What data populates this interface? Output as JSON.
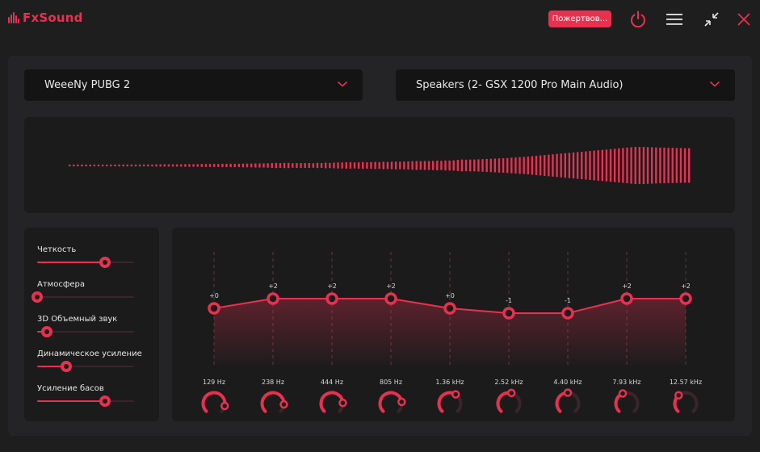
{
  "app": {
    "logo_text": "FxSound",
    "donate_label": "Пожертвов...",
    "accent_color": "#e8314f",
    "icons": [
      "power-icon",
      "menu-icon",
      "minimize-icon",
      "close-icon"
    ]
  },
  "preset": {
    "value": "WeeeNy PUBG 2"
  },
  "output": {
    "value": "Speakers (2- GSX 1200 Pro Main Audio)"
  },
  "effects": [
    {
      "label": "Четкость",
      "level": 0.7
    },
    {
      "label": "Атмосфера",
      "level": 0.0
    },
    {
      "label": "3D Объемный звук",
      "level": 0.1
    },
    {
      "label": "Динамическое усиление",
      "level": 0.3
    },
    {
      "label": "Усиление басов",
      "level": 0.7
    }
  ],
  "eq": {
    "bands": [
      {
        "freq": "129 Hz",
        "gain": 0,
        "gain_label": "+0"
      },
      {
        "freq": "238 Hz",
        "gain": 2,
        "gain_label": "+2"
      },
      {
        "freq": "444 Hz",
        "gain": 2,
        "gain_label": "+2"
      },
      {
        "freq": "805 Hz",
        "gain": 2,
        "gain_label": "+2"
      },
      {
        "freq": "1.36 kHz",
        "gain": 0,
        "gain_label": "+0"
      },
      {
        "freq": "2.52 kHz",
        "gain": -1,
        "gain_label": "-1"
      },
      {
        "freq": "4.40 kHz",
        "gain": -1,
        "gain_label": "-1"
      },
      {
        "freq": "7.93 kHz",
        "gain": 2,
        "gain_label": "+2"
      },
      {
        "freq": "12.57 kHz",
        "gain": 2,
        "gain_label": "+2"
      }
    ],
    "knob_levels": [
      0.88,
      0.85,
      0.82,
      0.8,
      0.62,
      0.55,
      0.5,
      0.42,
      0.35
    ]
  },
  "visualizer": {
    "levels": [
      0.04,
      0.04,
      0.04,
      0.04,
      0.04,
      0.04,
      0.04,
      0.04,
      0.04,
      0.04,
      0.04,
      0.04,
      0.05,
      0.05,
      0.05,
      0.05,
      0.05,
      0.05,
      0.05,
      0.05,
      0.05,
      0.06,
      0.06,
      0.06,
      0.06,
      0.06,
      0.06,
      0.06,
      0.07,
      0.07,
      0.07,
      0.07,
      0.08,
      0.08,
      0.08,
      0.08,
      0.08,
      0.09,
      0.09,
      0.09,
      0.09,
      0.09,
      0.1,
      0.1,
      0.1,
      0.11,
      0.11,
      0.11,
      0.12,
      0.13,
      0.14,
      0.13,
      0.14,
      0.14,
      0.12,
      0.13,
      0.13,
      0.13,
      0.13,
      0.12,
      0.14,
      0.13,
      0.15,
      0.14,
      0.15,
      0.16,
      0.16,
      0.17,
      0.17,
      0.16,
      0.17,
      0.18,
      0.17,
      0.18,
      0.19,
      0.18,
      0.2,
      0.19,
      0.2,
      0.21,
      0.2,
      0.21,
      0.22,
      0.23,
      0.24,
      0.23,
      0.24,
      0.24,
      0.25,
      0.26,
      0.25,
      0.27,
      0.27,
      0.28,
      0.3,
      0.32,
      0.31,
      0.32,
      0.32,
      0.33,
      0.34,
      0.35,
      0.36,
      0.37,
      0.38,
      0.39,
      0.4,
      0.42,
      0.43,
      0.45,
      0.46,
      0.48,
      0.5,
      0.52,
      0.54,
      0.56,
      0.58,
      0.6,
      0.62,
      0.64,
      0.66,
      0.68,
      0.7,
      0.72,
      0.74,
      0.76,
      0.78,
      0.8,
      0.82,
      0.84,
      0.86,
      0.88,
      0.9,
      0.92,
      0.94,
      0.96,
      0.98,
      1.0,
      1.0,
      1.0,
      0.99,
      0.98,
      0.97,
      0.96,
      0.96,
      0.95,
      0.95,
      0.94,
      0.94,
      0.93,
      0.93
    ]
  }
}
